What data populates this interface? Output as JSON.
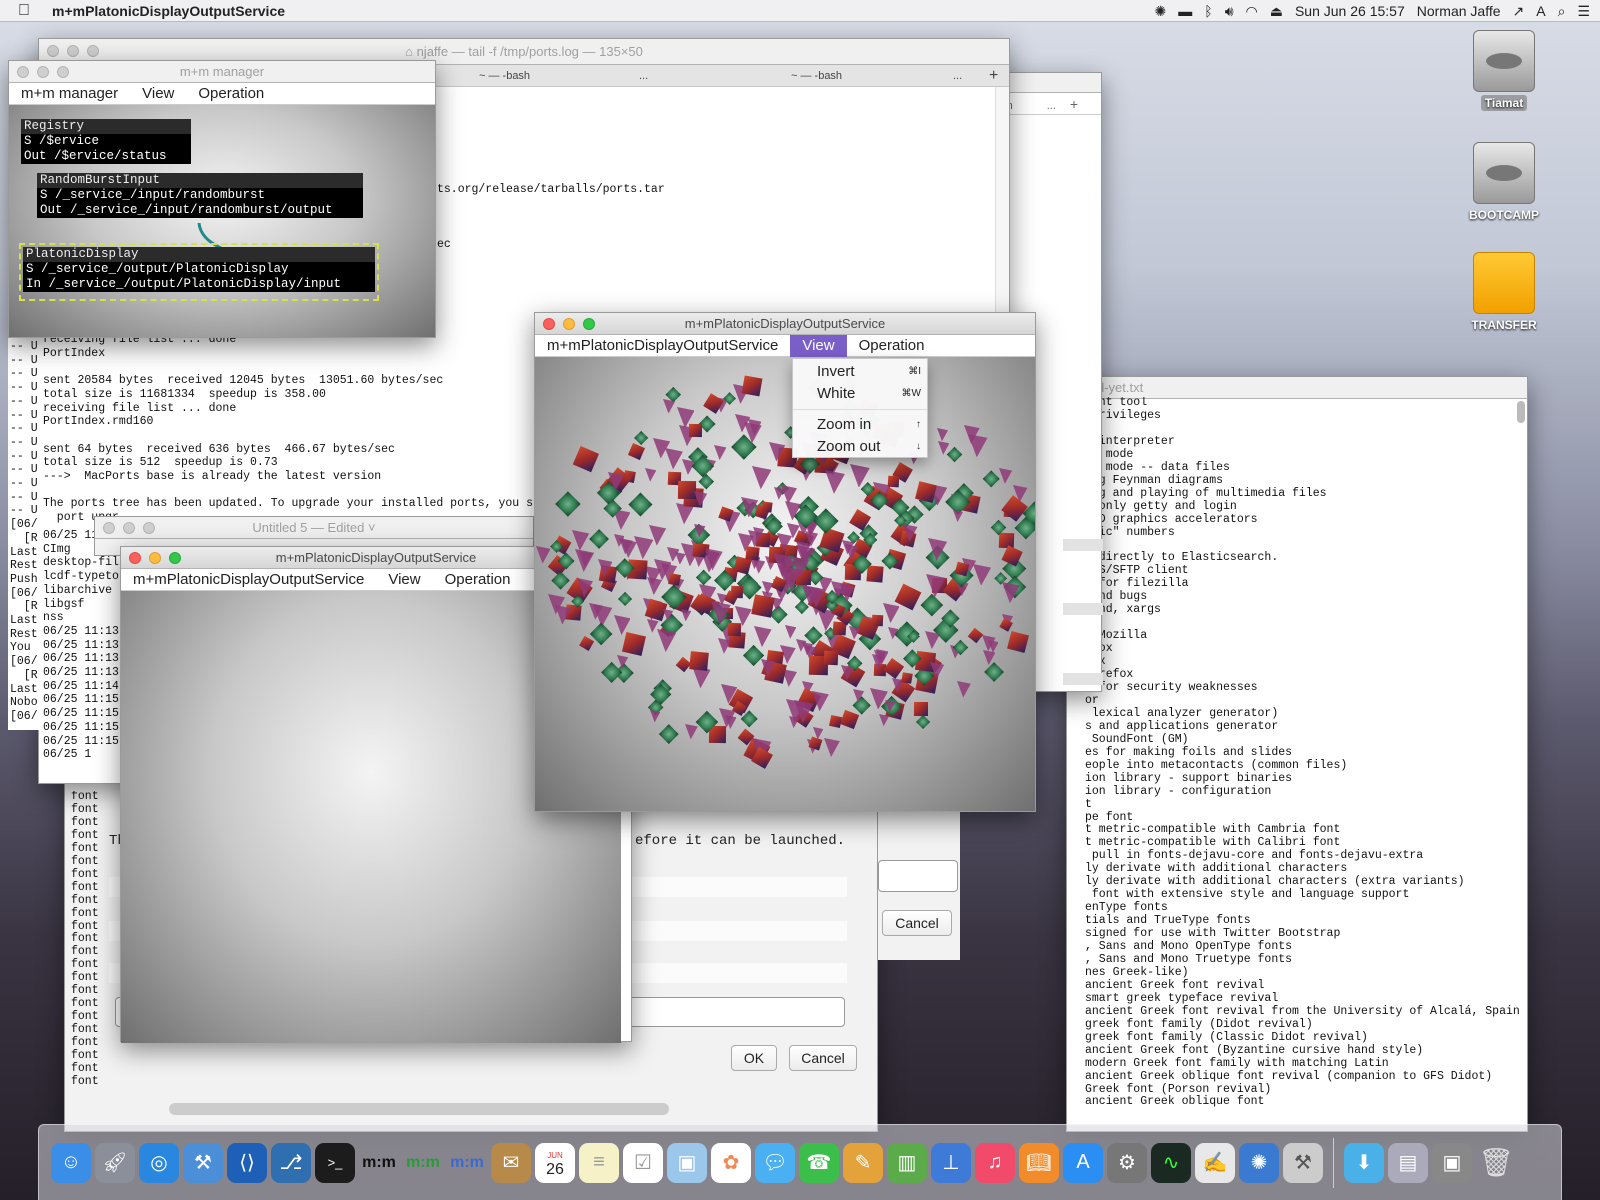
{
  "menubar": {
    "app_name": "m+mPlatonicDisplayOutputService",
    "datetime": "Sun Jun 26  15:57",
    "user": "Norman Jaffe"
  },
  "desktop": {
    "icons": [
      "Tiamat",
      "BOOTCAMP",
      "TRANSFER"
    ]
  },
  "terminal_main": {
    "title": "njaffe — tail -f /tmp/ports.log — 135×50",
    "tabs": [
      "~ — -bash",
      "~ — -bash"
    ],
    "lines": [
      "ts.org/release/tarballs/ports.tar",
      "ec"
    ],
    "body": "receiving file list ... done\nPortIndex\n\nsent 20584 bytes  received 12045 bytes  13051.60 bytes/sec\ntotal size is 11681334  speedup is 358.00\nreceiving file list ... done\nPortIndex.rmd160\n\nsent 64 bytes  received 636 bytes  466.67 bytes/sec\ntotal size is 512  speedup is 0.73\n--->  MacPorts base is already the latest version\n\nThe ports tree has been updated. To upgrade your installed ports, you sh\n  port upgr",
    "log": "06/25 11:13\nCImg\ndesktop-fil\nlcdf-typeto\nlibarchive\nlibgsf\nnss\n06/25 11:13\n06/25 11:13\n06/25 11:13\n06/25 11:13\n06/25 11:14\n06/25 11:15\n06/25 11:15\n06/25 11:15\n06/25 11:15\n06/25 1"
  },
  "terminal_left": {
    "prefix": "-- U\n-- U\n-- U\n-- U\n-- U\n-- U\n-- U\n-- U\n-- U\n-- U\n-- U\n-- U\n-- U\n[06/\n  [R\nLast\nRest\nPush\n[06/\n  [R\nLast\nRest\nYou \n[06/\n  [R\nLast\nNobo\n[06/"
  },
  "terminal_back": {
    "tab": "ash"
  },
  "textfile": {
    "title": "d-yet.txt",
    "text": "ment tool\n privileges\n\nd interpreter\ner mode\ner mode -- data files\ning Feynman diagrams\ning and playing of multimedia files\ne-only getty and login\nAMD graphics accelerators\nagic\" numbers\n\nr directly to Elasticsearch.\nTPS/SFTP client\ns for filezilla\nfind bugs\nfind, xargs\nam\nn Mozilla\nefox\nfox\nfirefox\ns for security weaknesses\nor\n lexical analyzer generator)\ns and applications generator\n SoundFont (GM)\nes for making foils and slides\neople into metacontacts (common files)\nion library - support binaries\nion library - configuration\nt\npe font\nt metric-compatible with Cambria font\nt metric-compatible with Calibri font\n pull in fonts-dejavu-core and fonts-dejavu-extra\nly derivate with additional characters\nly derivate with additional characters (extra variants)\n font with extensive style and language support\nenType fonts\ntials and TrueType fonts\nsigned for use with Twitter Bootstrap\n, Sans and Mono OpenType fonts\n, Sans and Mono Truetype fonts\nnes Greek-like)\nancient Greek font revival\nsmart greek typeface revival\nancient Greek font revival from the University of Alcalá, Spain\ngreek font family (Didot revival)\ngreek font family (Classic Didot revival)\nancient Greek font (Byzantine cursive hand style)\nmodern Greek font family with matching Latin\nancient Greek oblique font revival (companion to GFS Didot)\nGreek font (Porson revival)\nancient Greek oblique font"
  },
  "dialog": {
    "text_frag": "efore it can be launched.",
    "prefix": "Th",
    "ok": "OK",
    "cancel": "Cancel",
    "cancel2": "Cancel",
    "font_col": "font\nfont\nfont\nfont\nfont\nfont\nfont\nfont\nfont\nfont\nfont\nfont\nfont\nfont\nfont\nfont\nfont\nfont\nfont\nfont\nfont\nfont\nfont"
  },
  "untitled": {
    "title": "Untitled 5",
    "status": "— Edited ˅"
  },
  "manager": {
    "title": "m+m manager",
    "menu": [
      "m+m manager",
      "View",
      "Operation"
    ],
    "blocks": [
      {
        "rows": [
          "Registry",
          "S /$ervice",
          "Out /$ervice/status"
        ]
      },
      {
        "rows": [
          "RandomBurstInput",
          "S /_service_/input/randomburst",
          "Out /_service_/input/randomburst/output"
        ]
      },
      {
        "rows": [
          "PlatonicDisplay",
          "S /_service_/output/PlatonicDisplay",
          "In /_service_/output/PlatonicDisplay/input"
        ]
      }
    ]
  },
  "platonic_front": {
    "title": "m+mPlatonicDisplayOutputService",
    "menu": [
      "m+mPlatonicDisplayOutputService",
      "View",
      "Operation"
    ]
  },
  "platonic_back": {
    "title": "m+mPlatonicDisplayOutputService",
    "menu": [
      "m+mPlatonicDisplayOutputService",
      "View",
      "Operation"
    ]
  },
  "view_menu": {
    "items": [
      {
        "label": "Invert",
        "key": "⌘I"
      },
      {
        "label": "White",
        "key": "⌘W"
      },
      {
        "label": "Zoom in",
        "key": "↑"
      },
      {
        "label": "Zoom out",
        "key": "↓"
      }
    ]
  },
  "dock": {
    "calendar_day": "26",
    "calendar_month": "JUN"
  },
  "colors": {
    "menu_highlight": "#7a5fc8",
    "pyramid": "#8e3a78",
    "cube_red": "#9c2a2a",
    "cube_green": "#2f7a4e"
  }
}
